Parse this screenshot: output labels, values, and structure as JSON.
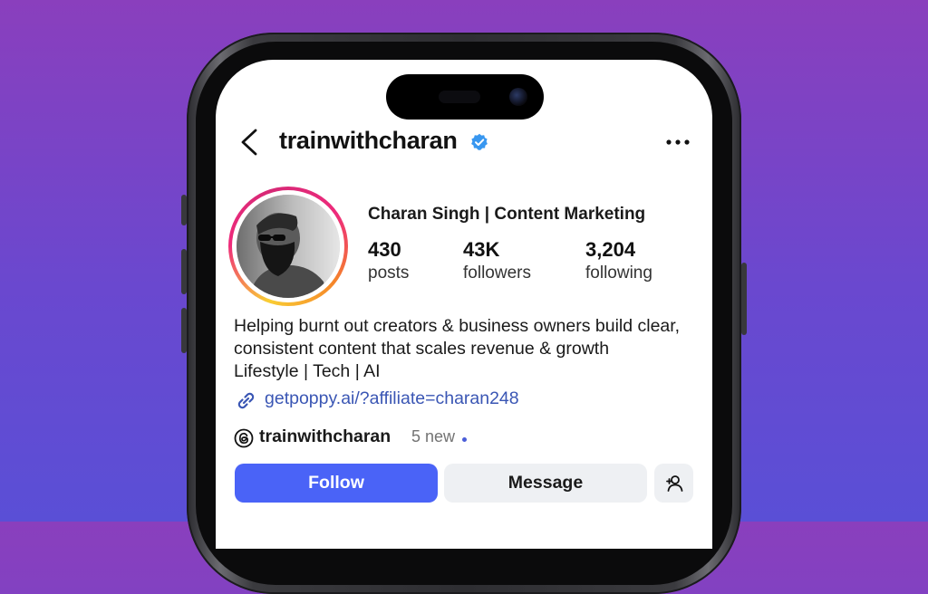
{
  "profile": {
    "username": "trainwithcharan",
    "display_name": "Charan Singh | Content Marketing",
    "verified": true,
    "stats": [
      {
        "value": "430",
        "label": "posts"
      },
      {
        "value": "43K",
        "label": "followers"
      },
      {
        "value": "3,204",
        "label": "following"
      }
    ],
    "bio": [
      "Helping burnt out creators & business owners build clear,",
      "consistent content that scales revenue & growth",
      "Lifestyle | Tech | AI"
    ],
    "link": "getpoppy.ai/?affiliate=charan248",
    "threads": {
      "handle": "trainwithcharan",
      "new_label": "5 new"
    }
  },
  "actions": {
    "follow_label": "Follow",
    "message_label": "Message"
  },
  "icons": {
    "back": "chevron-left-icon",
    "verified": "verified-badge-icon",
    "more": "more-horizontal-icon",
    "link": "link-icon",
    "threads": "threads-icon",
    "add_user": "add-user-icon"
  },
  "colors": {
    "background_top": "#8a3fbd",
    "background_bottom": "#5a4fd6",
    "follow_button": "#4a63f7",
    "link_text": "#3a56b4",
    "verified": "#3897f0"
  }
}
